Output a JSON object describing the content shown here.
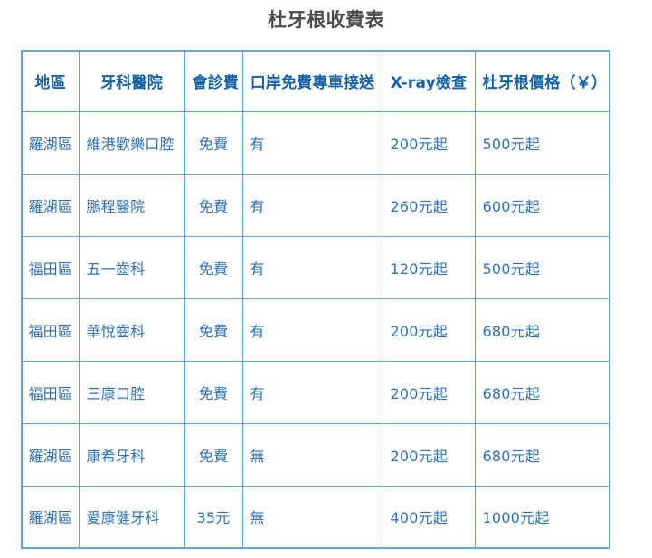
{
  "page": {
    "title": "杜牙根收費表"
  },
  "table": {
    "columns": [
      {
        "key": "area",
        "label": "地區"
      },
      {
        "key": "clinic",
        "label": "牙科醫院"
      },
      {
        "key": "consult",
        "label": "會診費"
      },
      {
        "key": "shuttle",
        "label": "口岸免費專車接送"
      },
      {
        "key": "xray",
        "label": "X-ray檢查"
      },
      {
        "key": "price",
        "label": "杜牙根價格（￥）"
      }
    ],
    "rows": [
      {
        "area": "羅湖區",
        "clinic": "維港歡樂口腔",
        "consult": "免費",
        "shuttle": "有",
        "xray": "200元起",
        "price": "500元起"
      },
      {
        "area": "羅湖區",
        "clinic": "鵬程醫院",
        "consult": "免費",
        "shuttle": "有",
        "xray": "260元起",
        "price": "600元起"
      },
      {
        "area": "福田區",
        "clinic": "五一齒科",
        "consult": "免費",
        "shuttle": "有",
        "xray": "120元起",
        "price": "500元起"
      },
      {
        "area": "福田區",
        "clinic": "華悅齒科",
        "consult": "免費",
        "shuttle": "有",
        "xray": "200元起",
        "price": "680元起"
      },
      {
        "area": "福田區",
        "clinic": "三康口腔",
        "consult": "免費",
        "shuttle": "有",
        "xray": "200元起",
        "price": "680元起"
      },
      {
        "area": "羅湖區",
        "clinic": "康希牙科",
        "consult": "免費",
        "shuttle": "無",
        "xray": "200元起",
        "price": "680元起"
      },
      {
        "area": "羅湖區",
        "clinic": "愛康健牙科",
        "consult": "35元",
        "shuttle": "無",
        "xray": "400元起",
        "price": "1000元起"
      }
    ]
  },
  "colors": {
    "border": "#5aa5ec",
    "header_text": "#1462a8",
    "body_text": "#2e72ba",
    "title_text": "#4d4d4d",
    "background": "#ffffff"
  }
}
